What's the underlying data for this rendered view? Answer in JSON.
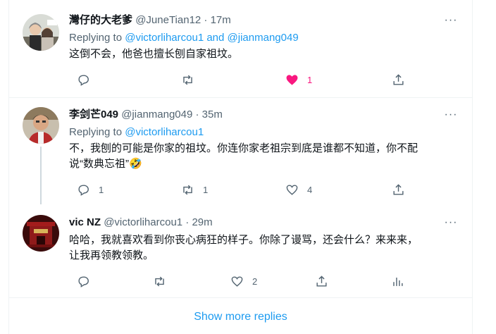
{
  "tweets": [
    {
      "name": "灣仔的大老爹",
      "handle": "@JuneTian12",
      "time": "· 17m",
      "replying_prefix": "Replying to",
      "replying_to_1": "@victorliharcou1",
      "replying_and": "and",
      "replying_to_2": "@jianmang049",
      "text": "这倒不会，他爸也擅长刨自家祖坟。",
      "reply_count": "",
      "retweet_count": "",
      "like_count": "1",
      "liked": true,
      "avatar_icon": "avatar-two-people-photo"
    },
    {
      "name": "李剑芒049",
      "handle": "@jianmang049",
      "time": "· 35m",
      "replying_prefix": "Replying to",
      "replying_to_1": "@victorliharcou1",
      "text_line1": "不，我刨的可能是你家的祖坟。你连你家老祖宗到底是谁都不知道，你不配",
      "text_line2": "说“数典忘祖”🤣",
      "reply_count": "1",
      "retweet_count": "1",
      "like_count": "4",
      "avatar_icon": "avatar-man-photo"
    },
    {
      "name": "vic NZ",
      "handle": "@victorliharcou1",
      "time": "· 29m",
      "text_line1": "哈哈，我就喜欢看到你丧心病狂的样子。你除了谩骂，还会什么？来来来，",
      "text_line2": "让我再领教领教。",
      "reply_count": "",
      "retweet_count": "",
      "like_count": "2",
      "avatar_icon": "avatar-red-building-photo"
    }
  ],
  "show_more": "Show more replies",
  "colors": {
    "accent": "#1d9bf0",
    "like": "#f91880",
    "muted": "#536471",
    "line": "#cfd9de"
  }
}
